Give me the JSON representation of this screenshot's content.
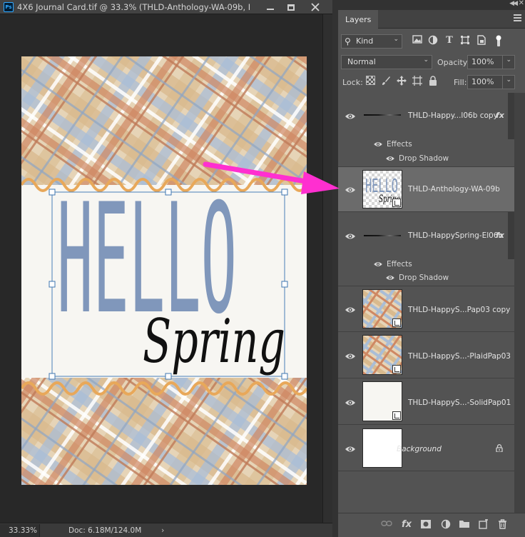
{
  "document": {
    "title": "4X6 Journal Card.tif @ 33.3% (THLD-Anthology-WA-09b, RGB...",
    "app_badge": "Ps",
    "zoom": "33.33%",
    "doc_info": "Doc: 6.18M/124.0M",
    "status_arrow": "›"
  },
  "panel": {
    "tab": "Layers",
    "filter_kind": "Kind",
    "blend_mode": "Normal",
    "opacity_label": "Opacity:",
    "opacity": "100%",
    "lock_label": "Lock:",
    "fill_label": "Fill:",
    "fill": "100%"
  },
  "layers": [
    {
      "name": "THLD-Happy...l06b copy",
      "has_fx": true,
      "effects_label": "Effects",
      "effect": "Drop Shadow"
    },
    {
      "name": "THLD-Anthology-WA-09b",
      "selected": true
    },
    {
      "name": "THLD-HappySpring-El06b",
      "has_fx": true,
      "effects_label": "Effects",
      "effect": "Drop Shadow"
    },
    {
      "name": "THLD-HappyS...Pap03 copy"
    },
    {
      "name": "THLD-HappyS...-PlaidPap03"
    },
    {
      "name": "THLD-HappyS...-SolidPap01"
    },
    {
      "name": "Background",
      "locked": true
    }
  ],
  "artwork": {
    "word_hello": "HELLO",
    "word_spring": "Spring"
  },
  "colors": {
    "accent_arrow": "#ff2fd0",
    "hello_blue": "#8097bb",
    "zigzag_orange": "#e8a85a",
    "plaid_tan": "#e0c39a",
    "plaid_rust": "#d08a63",
    "plaid_blue": "#a9bdd6"
  },
  "icons": {
    "fx": "fx"
  }
}
